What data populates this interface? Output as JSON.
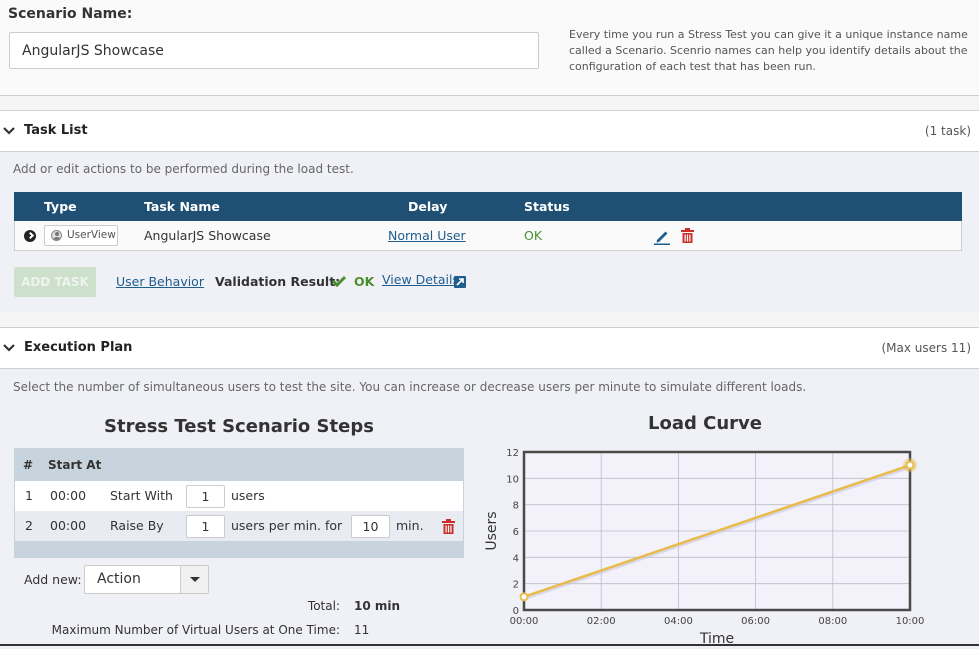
{
  "scenario": {
    "label": "Scenario Name:",
    "value": "AngularJS Showcase",
    "help": "Every time you run a Stress Test you can give it a unique instance name called a Scenario. Scenrio names can help you identify details about the configuration of each test that has been run."
  },
  "task_list": {
    "title": "Task List",
    "count": "(1 task)",
    "description": "Add or edit actions to be performed during the load test.",
    "columns": [
      "Type",
      "Task Name",
      "Delay",
      "Status"
    ],
    "rows": [
      {
        "type": "UserView",
        "name": "AngularJS Showcase",
        "delay": "Normal User",
        "status": "OK"
      }
    ],
    "add_task": "ADD TASK",
    "user_behavior": "User Behavior",
    "validation_label": "Validation Result:",
    "validation_status": "OK",
    "view_details": "View Details"
  },
  "execution_plan": {
    "title": "Execution Plan",
    "count": "(Max users 11)",
    "description": "Select the number of simultaneous users to test the site. You can increase or decrease users per minute to simulate different loads.",
    "steps_title": "Stress Test Scenario Steps",
    "columns": [
      "#",
      "Start At"
    ],
    "steps": [
      {
        "num": "1",
        "start": "00:00",
        "action": "Start With",
        "value": "1",
        "unit": "users"
      },
      {
        "num": "2",
        "start": "00:00",
        "action": "Raise By",
        "value": "1",
        "unit": "users per min. for",
        "duration": "10",
        "duration_unit": "min."
      }
    ],
    "add_new_label": "Add new:",
    "add_new_value": "Action",
    "total_label": "Total:",
    "total_value": "10 min",
    "max_label": "Maximum Number of Virtual Users at One Time:",
    "max_value": "11"
  },
  "colors": {
    "header_blue": "#1f5073",
    "ok_green": "#4a8f2e",
    "link_blue": "#1f5d8f",
    "danger_red": "#c9302c",
    "curve_yellow": "#e8bb4a"
  },
  "chart_data": {
    "type": "line",
    "title": "Load Curve",
    "xlabel": "Time",
    "ylabel": "Users",
    "x_ticks": [
      "00:00",
      "02:00",
      "04:00",
      "06:00",
      "08:00",
      "10:00"
    ],
    "y_ticks": [
      0,
      2,
      4,
      6,
      8,
      10,
      12
    ],
    "xlim": [
      0,
      10
    ],
    "ylim": [
      0,
      12
    ],
    "grid": true,
    "series": [
      {
        "name": "Users",
        "x": [
          0,
          10
        ],
        "values": [
          1,
          11
        ]
      }
    ]
  }
}
